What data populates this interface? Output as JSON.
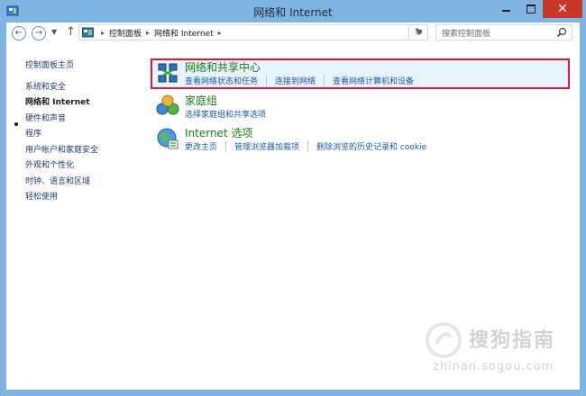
{
  "window": {
    "title": "网络和 Internet"
  },
  "address": {
    "crumbs": [
      "控制面板",
      "网络和 Internet"
    ],
    "search_placeholder": "搜索控制面板"
  },
  "sidebar": {
    "items": [
      {
        "label": "控制面板主页",
        "current": false
      },
      {
        "label": "系统和安全",
        "current": false
      },
      {
        "label": "网络和 Internet",
        "current": true
      },
      {
        "label": "硬件和声音",
        "current": false
      },
      {
        "label": "程序",
        "current": false
      },
      {
        "label": "用户帐户和家庭安全",
        "current": false
      },
      {
        "label": "外观和个性化",
        "current": false
      },
      {
        "label": "时钟、语言和区域",
        "current": false
      },
      {
        "label": "轻松使用",
        "current": false
      }
    ]
  },
  "categories": [
    {
      "title": "网络和共享中心",
      "icon": "network-center-icon",
      "links": [
        "查看网络状态和任务",
        "连接到网络",
        "查看网络计算机和设备"
      ]
    },
    {
      "title": "家庭组",
      "icon": "homegroup-icon",
      "links": [
        "选择家庭组和共享选项"
      ]
    },
    {
      "title": "Internet 选项",
      "icon": "internet-options-icon",
      "links": [
        "更改主页",
        "管理浏览器加载项",
        "删除浏览的历史记录和 cookie"
      ]
    }
  ],
  "watermark": {
    "brand": "搜狗指南",
    "url": "zhinan.sogou.com"
  },
  "colors": {
    "frame": "#7eb4e4",
    "close_button": "#c7382b",
    "highlight_border": "#e0182f",
    "category_title": "#1a7a1a",
    "link": "#1c5aa8"
  }
}
